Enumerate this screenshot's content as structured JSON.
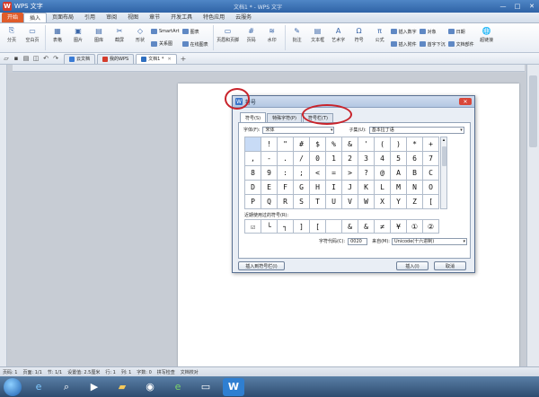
{
  "window": {
    "app_icon_text": "W",
    "app_title": "WPS 文字",
    "doc_title": "文档1 * - WPS 文字",
    "controls": [
      "—",
      "□",
      "✕"
    ]
  },
  "menu_tabs": [
    "开始",
    "插入",
    "页面布局",
    "引用",
    "审阅",
    "视图",
    "章节",
    "开发工具",
    "特色应用",
    "云服务"
  ],
  "ribbon": {
    "group1": [
      "分页",
      "空白页"
    ],
    "group2": [
      "表格",
      "图片",
      "图库",
      "截屏",
      "形状"
    ],
    "small1": [
      "SmartArt",
      "关系图"
    ],
    "small2": [
      "图表",
      "在线图表"
    ],
    "group3": [
      "页眉和页脚",
      "页码",
      "水印"
    ],
    "group4": [
      "批注",
      "文本框",
      "艺术字",
      "符号",
      "公式"
    ],
    "small3": [
      "插入数字",
      "插入附件"
    ],
    "small4": [
      "对象",
      "首字下沉"
    ],
    "small5": [
      "日期",
      "文档部件"
    ],
    "group5": [
      "超链接"
    ]
  },
  "toolbar2": {
    "tabs": [
      {
        "label": "云文档",
        "color": "#3a7bd5"
      },
      {
        "label": "我的WPS",
        "color": "#d43c2c"
      },
      {
        "label": "文档1 *",
        "color": "#2f6fc0"
      }
    ],
    "add": "+"
  },
  "dialog": {
    "title": "符号",
    "close": "✕",
    "tabs": [
      "符号(S)",
      "特殊字符(P)",
      "符号栏(T)"
    ],
    "font_label": "字体(F):",
    "font_value": "宋体",
    "subset_label": "子集(U):",
    "subset_value": "基本拉丁语",
    "symbols": [
      "",
      "!",
      "\"",
      "#",
      "$",
      "%",
      "&",
      "'",
      "(",
      ")",
      "*",
      "+",
      ",",
      "-",
      ".",
      "/",
      "0",
      "1",
      "2",
      "3",
      "4",
      "5",
      "6",
      "7",
      "8",
      "9",
      ":",
      ";",
      "<",
      "=",
      ">",
      "?",
      "@",
      "A",
      "B",
      "C",
      "D",
      "E",
      "F",
      "G",
      "H",
      "I",
      "J",
      "K",
      "L",
      "M",
      "N",
      "O",
      "P",
      "Q",
      "R",
      "S",
      "T",
      "U",
      "V",
      "W",
      "X",
      "Y",
      "Z",
      "["
    ],
    "recent_label": "近期使用过的符号(R):",
    "recent": [
      "☑",
      "└",
      "┐",
      "]",
      "[",
      "",
      "&",
      "&",
      "≠",
      "¥",
      "①",
      "②"
    ],
    "code_label": "字符代码(C):",
    "code_value": "0020",
    "from_label": "来自(M):",
    "from_value": "Unicode(十六进制)",
    "btn_symbol_bar": "插入到符号栏(I)",
    "btn_insert": "插入(I)",
    "btn_cancel": "取消"
  },
  "status": [
    "页码: 1",
    "页面: 1/1",
    "节: 1/1",
    "设置值: 2.5厘米",
    "行: 1",
    "列: 1",
    "字数: 0",
    "拼写检查",
    "文档校对"
  ],
  "colors": {
    "annotation_red": "#c8232b",
    "title_blue": "#2f63a6",
    "ribbon_icon": "#3a66a8"
  }
}
